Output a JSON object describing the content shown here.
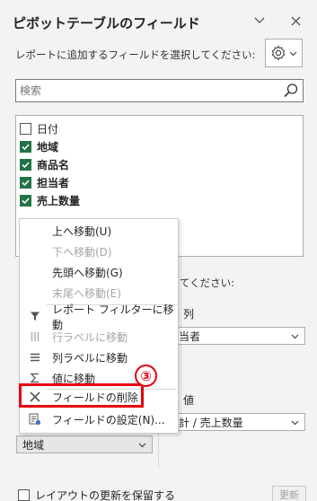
{
  "panel": {
    "title": "ピボットテーブルのフィールド",
    "subtitle": "レポートに追加するフィールドを選択してください:",
    "collapse_icon": "chevron-down-icon",
    "close_icon": "close-icon",
    "settings_icon": "gear-icon"
  },
  "search": {
    "placeholder": "検索",
    "value": ""
  },
  "fields": [
    {
      "label": "日付",
      "checked": false
    },
    {
      "label": "地域",
      "checked": true
    },
    {
      "label": "商品名",
      "checked": true
    },
    {
      "label": "担当者",
      "checked": true
    },
    {
      "label": "売上数量",
      "checked": true
    }
  ],
  "areas": {
    "hint": "てください:",
    "columns": {
      "title": "列",
      "value": "担当者"
    },
    "values": {
      "title": "値",
      "value": "合計 / 売上数量"
    },
    "rows": {
      "value": "地域"
    }
  },
  "context_menu": {
    "items": [
      {
        "label": "上へ移動(U)",
        "disabled": false,
        "icon": ""
      },
      {
        "label": "下へ移動(D)",
        "disabled": true,
        "icon": ""
      },
      {
        "label": "先頭へ移動(G)",
        "disabled": false,
        "icon": ""
      },
      {
        "label": "末尾へ移動(E)",
        "disabled": true,
        "icon": ""
      },
      {
        "label": "レポート フィルターに移動",
        "disabled": false,
        "icon": "filter-icon"
      },
      {
        "label": "行ラベルに移動",
        "disabled": true,
        "icon": "rows-icon"
      },
      {
        "label": "列ラベルに移動",
        "disabled": false,
        "icon": "columns-icon"
      },
      {
        "label": "値に移動",
        "disabled": false,
        "icon": "sigma-icon"
      },
      {
        "label": "フィールドの削除",
        "disabled": false,
        "icon": "remove-field-icon"
      },
      {
        "label": "フィールドの設定(N)...",
        "disabled": false,
        "icon": "field-settings-icon"
      }
    ]
  },
  "annotation": {
    "badge": "③",
    "color": "#e60012"
  },
  "footer": {
    "defer_label": "レイアウトの更新を保留する",
    "update_label": "更新"
  },
  "colors": {
    "checkbox": "#217346",
    "background": "#f3f3f3"
  }
}
